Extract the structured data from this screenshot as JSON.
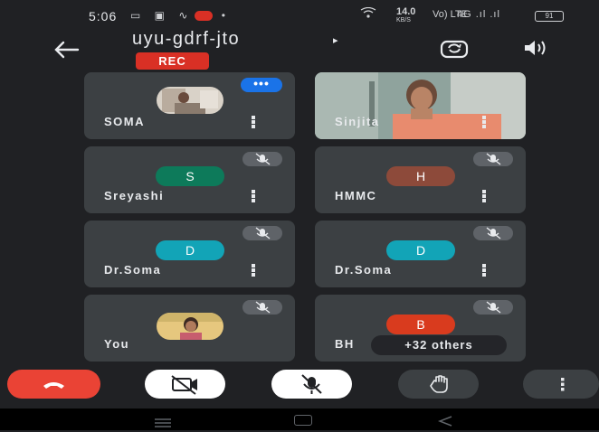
{
  "status_bar": {
    "time": "5:06",
    "left_icons": "▭ ▣ ∿",
    "dot": "•",
    "speed_value": "14.0",
    "speed_unit": "KB/S",
    "network": "Vo) LTE",
    "signal": "4G .ıl .ıl",
    "battery": "91"
  },
  "header": {
    "title": "uyu-gdrf-jto",
    "title_caret": "▸",
    "rec_label": "REC"
  },
  "participants": [
    {
      "name": "SOMA",
      "type": "photo",
      "badge": "•••"
    },
    {
      "name": "Sinjita",
      "type": "video"
    },
    {
      "name": "Sreyashi",
      "type": "initial",
      "initial": "S",
      "color": "#0d7a5a"
    },
    {
      "name": "HMMC",
      "type": "initial",
      "initial": "H",
      "color": "#8d4a3a"
    },
    {
      "name": "Dr.Soma",
      "type": "initial",
      "initial": "D",
      "color": "#12a4b7"
    },
    {
      "name": "Dr.Soma",
      "type": "initial",
      "initial": "D",
      "color": "#12a4b7"
    },
    {
      "name": "You",
      "type": "photo"
    },
    {
      "name": "BH",
      "type": "initial",
      "initial": "B",
      "color": "#d93b1e",
      "others": "+32 others"
    }
  ],
  "colors": {
    "background": "#202124",
    "tile": "#3c4043",
    "end_call": "#ea4335",
    "rec": "#d93025"
  }
}
